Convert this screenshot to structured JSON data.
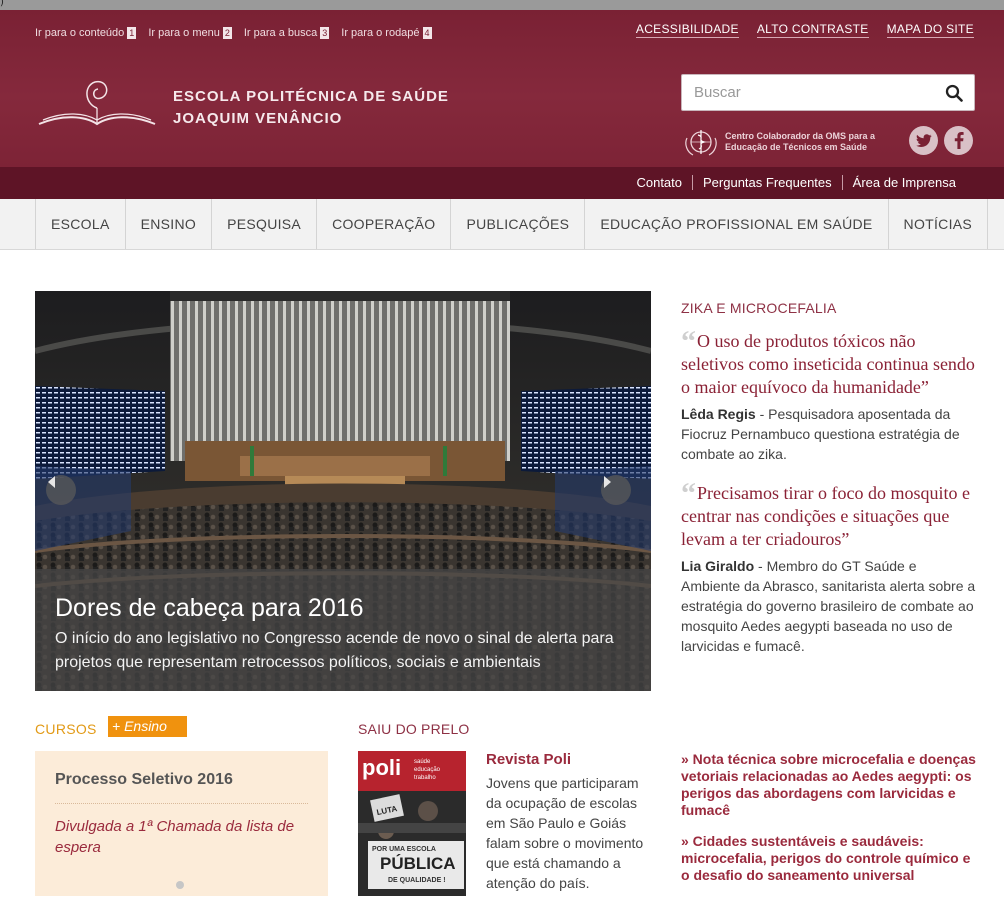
{
  "top_strip": {
    "glyph": ")"
  },
  "skip_links": [
    {
      "label": "Ir para o conteúdo",
      "num": "1"
    },
    {
      "label": "Ir para o menu",
      "num": "2"
    },
    {
      "label": "Ir para a busca",
      "num": "3"
    },
    {
      "label": "Ir para o rodapé",
      "num": "4"
    }
  ],
  "util_links": [
    "ACESSIBILIDADE",
    "ALTO CONTRASTE",
    "MAPA DO SITE"
  ],
  "site": {
    "name_line1": "ESCOLA POLITÉCNICA DE SAÚDE",
    "name_line2": "JOAQUIM VENÂNCIO"
  },
  "search": {
    "placeholder": "Buscar",
    "icon": "search-icon"
  },
  "who": {
    "line1": "Centro Colaborador da OMS para a",
    "line2": "Educação de Técnicos em Saúde"
  },
  "social": [
    "twitter-icon",
    "facebook-icon"
  ],
  "subbar_links": [
    "Contato",
    "Perguntas Frequentes",
    "Área de Imprensa"
  ],
  "nav": [
    "ESCOLA",
    "ENSINO",
    "PESQUISA",
    "COOPERAÇÃO",
    "PUBLICAÇÕES",
    "EDUCAÇÃO PROFISSIONAL EM SAÚDE",
    "NOTÍCIAS"
  ],
  "slider": {
    "title": "Dores de cabeça para 2016",
    "text": "O início do ano legislativo no Congresso acende de novo o sinal de alerta para projetos que representam retrocessos políticos, sociais e ambientais"
  },
  "zika": {
    "label": "ZIKA E MICROCEFALIA",
    "quotes": [
      {
        "text": "O uso de produtos tóxicos não seletivos como inseticida continua sendo o maior equívoco da humanidade”",
        "author": "Lêda Regis",
        "desc": " - Pesquisadora aposentada da Fiocruz Pernambuco questiona estratégia de combate ao zika."
      },
      {
        "text": "Precisamos tirar o foco do mosquito e centrar nas condições e situações que levam a ter criadouros”",
        "author": "Lia Giraldo",
        "desc": " - Membro do GT Saúde e Ambiente da Abrasco, sanitarista alerta sobre a estratégia do governo brasileiro de combate ao mosquito Aedes aegypti baseada no uso de larvicidas e fumacê."
      }
    ]
  },
  "cursos": {
    "label": "CURSOS",
    "badge": "+ Ensino",
    "title": "Processo Seletivo 2016",
    "link": "Divulgada a 1ª Chamada da lista de espera"
  },
  "prelo": {
    "label": "SAIU DO PRELO",
    "cover": {
      "brand": "poli",
      "side1": "saúde",
      "side2": "educação",
      "side3": "trabalho",
      "sign": "LUTA",
      "banner1": "POR UMA ESCOLA",
      "banner2": "PÚBLICA",
      "banner3": "DE QUALIDADE !"
    },
    "title": "Revista Poli",
    "text": "Jovens que participaram da ocupação de escolas em São Paulo e Goiás falam sobre o movimento que está chamando a atenção do país."
  },
  "news": [
    "» Nota técnica sobre microcefalia e doenças vetoriais relacionadas ao Aedes aegypti: os perigos das abordagens com larvicidas e fumacê",
    "» Cidades sustentáveis e saudáveis: microcefalia, perigos do controle químico e o desafio do saneamento universal"
  ]
}
